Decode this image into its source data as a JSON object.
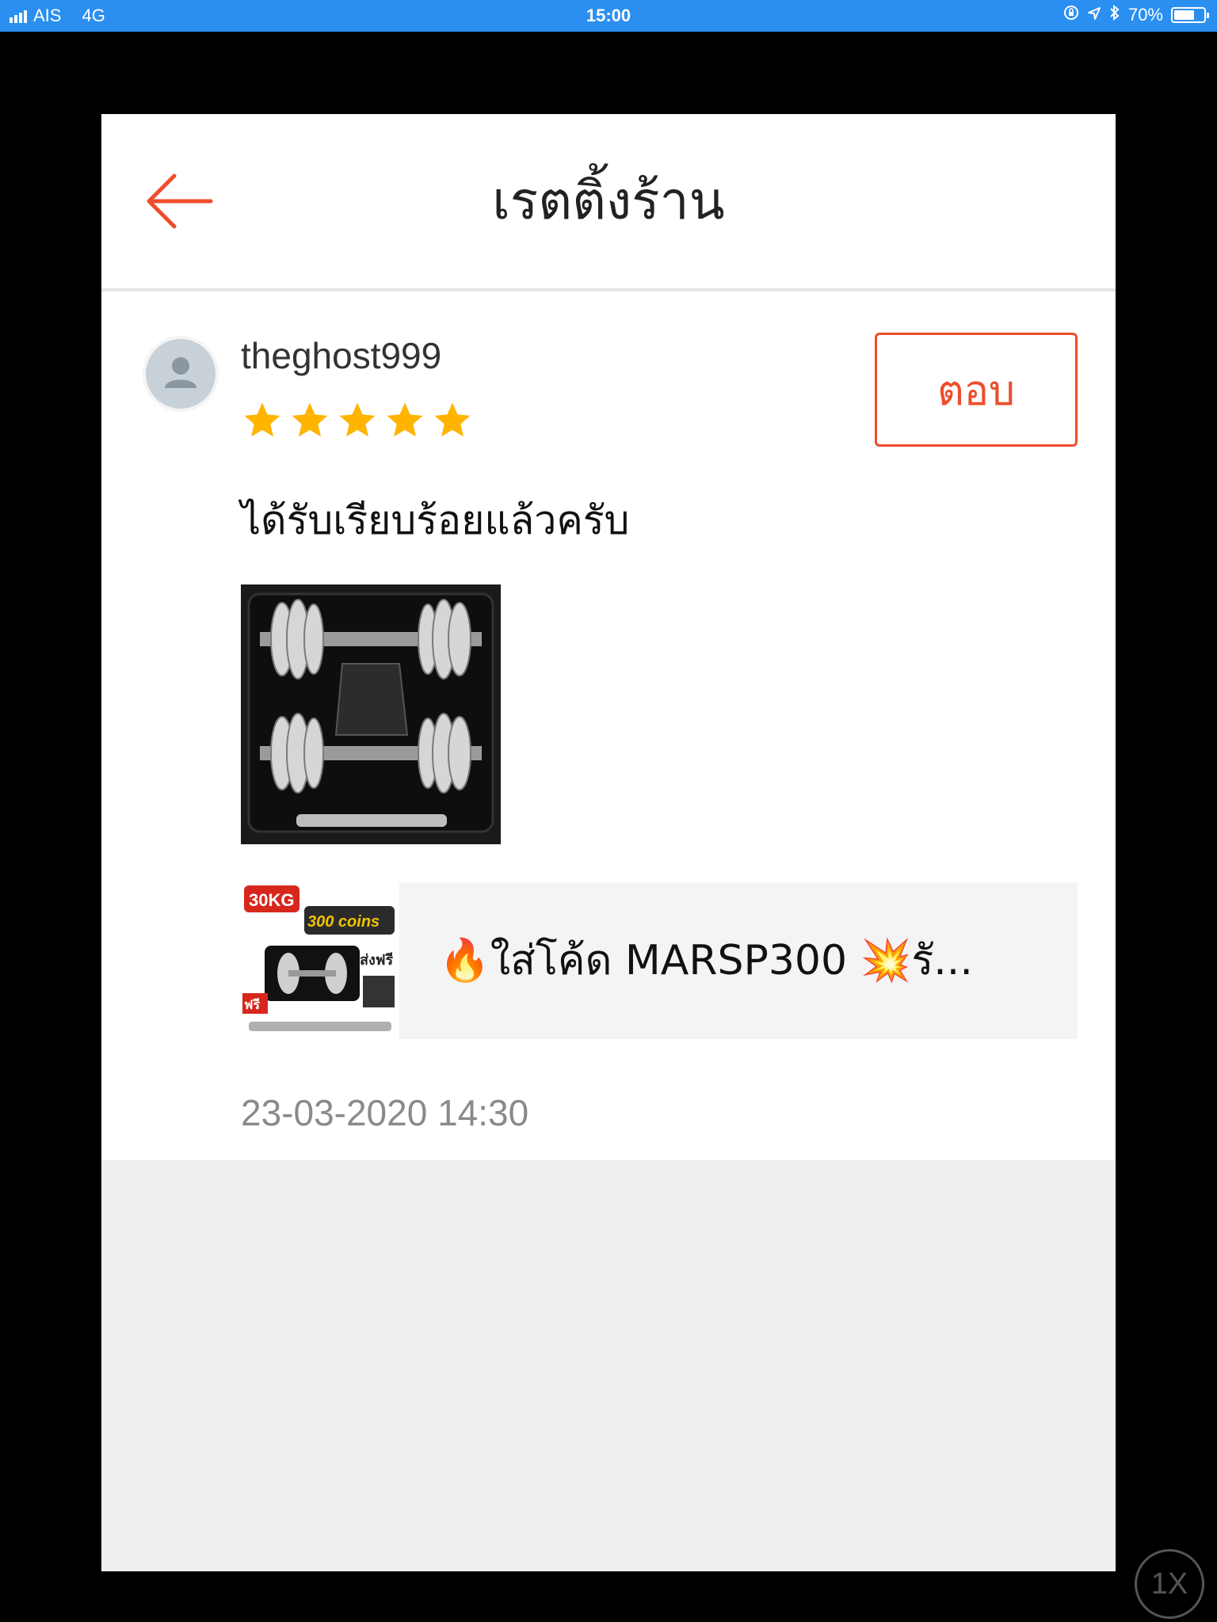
{
  "status_bar": {
    "carrier": "AIS",
    "network": "4G",
    "time": "15:00",
    "battery": "70%",
    "battery_level": 0.7
  },
  "header": {
    "back_icon": "arrow-left-icon",
    "title": "เรตติ้งร้าน"
  },
  "review": {
    "username": "theghost999",
    "rating": 5,
    "max_rating": 5,
    "reply_label": "ตอบ",
    "comment": "ได้รับเรียบร้อยแล้วครับ",
    "product_title": "🔥ใส่โค้ด MARSP300 💥รั...",
    "product_thumb": {
      "badge": "30KG",
      "coins": "300 coins",
      "free_ship": "ส่งฟรี",
      "free": "ฟรี"
    },
    "timestamp": "23-03-2020 14:30"
  },
  "playback": {
    "speed_label": "1X"
  },
  "colors": {
    "accent": "#ee4d2d",
    "star": "#ffb400",
    "status_bar": "#2a8ff0"
  }
}
